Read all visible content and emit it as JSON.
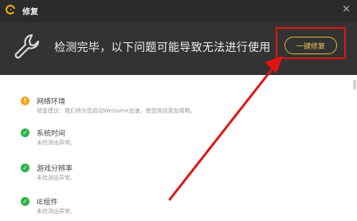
{
  "window": {
    "title": "修复",
    "close_glyph": "×"
  },
  "header": {
    "headline": "检测完毕，以下问题可能导致无法进行使用",
    "fix_button": "一键修复"
  },
  "items": [
    {
      "status": "warn",
      "title": "网络环境",
      "desc": "修复建议：我们将为您启动WeGame加速，使您体验更加顺畅。"
    },
    {
      "status": "ok",
      "title": "系统时间",
      "desc": "未检测出异常。"
    },
    {
      "status": "ok",
      "title": "游戏分辨率",
      "desc": "未检测出异常。"
    },
    {
      "status": "ok",
      "title": "IE组件",
      "desc": "未检测出异常。"
    }
  ],
  "icons": {
    "app": "wegame-logo-icon",
    "wrench": "wrench-icon",
    "warn": "warning-icon",
    "ok": "check-icon"
  },
  "colors": {
    "accent": "#e3b53a",
    "ok": "#2eb34a",
    "warn": "#f2a516",
    "annotation": "#e11414"
  }
}
